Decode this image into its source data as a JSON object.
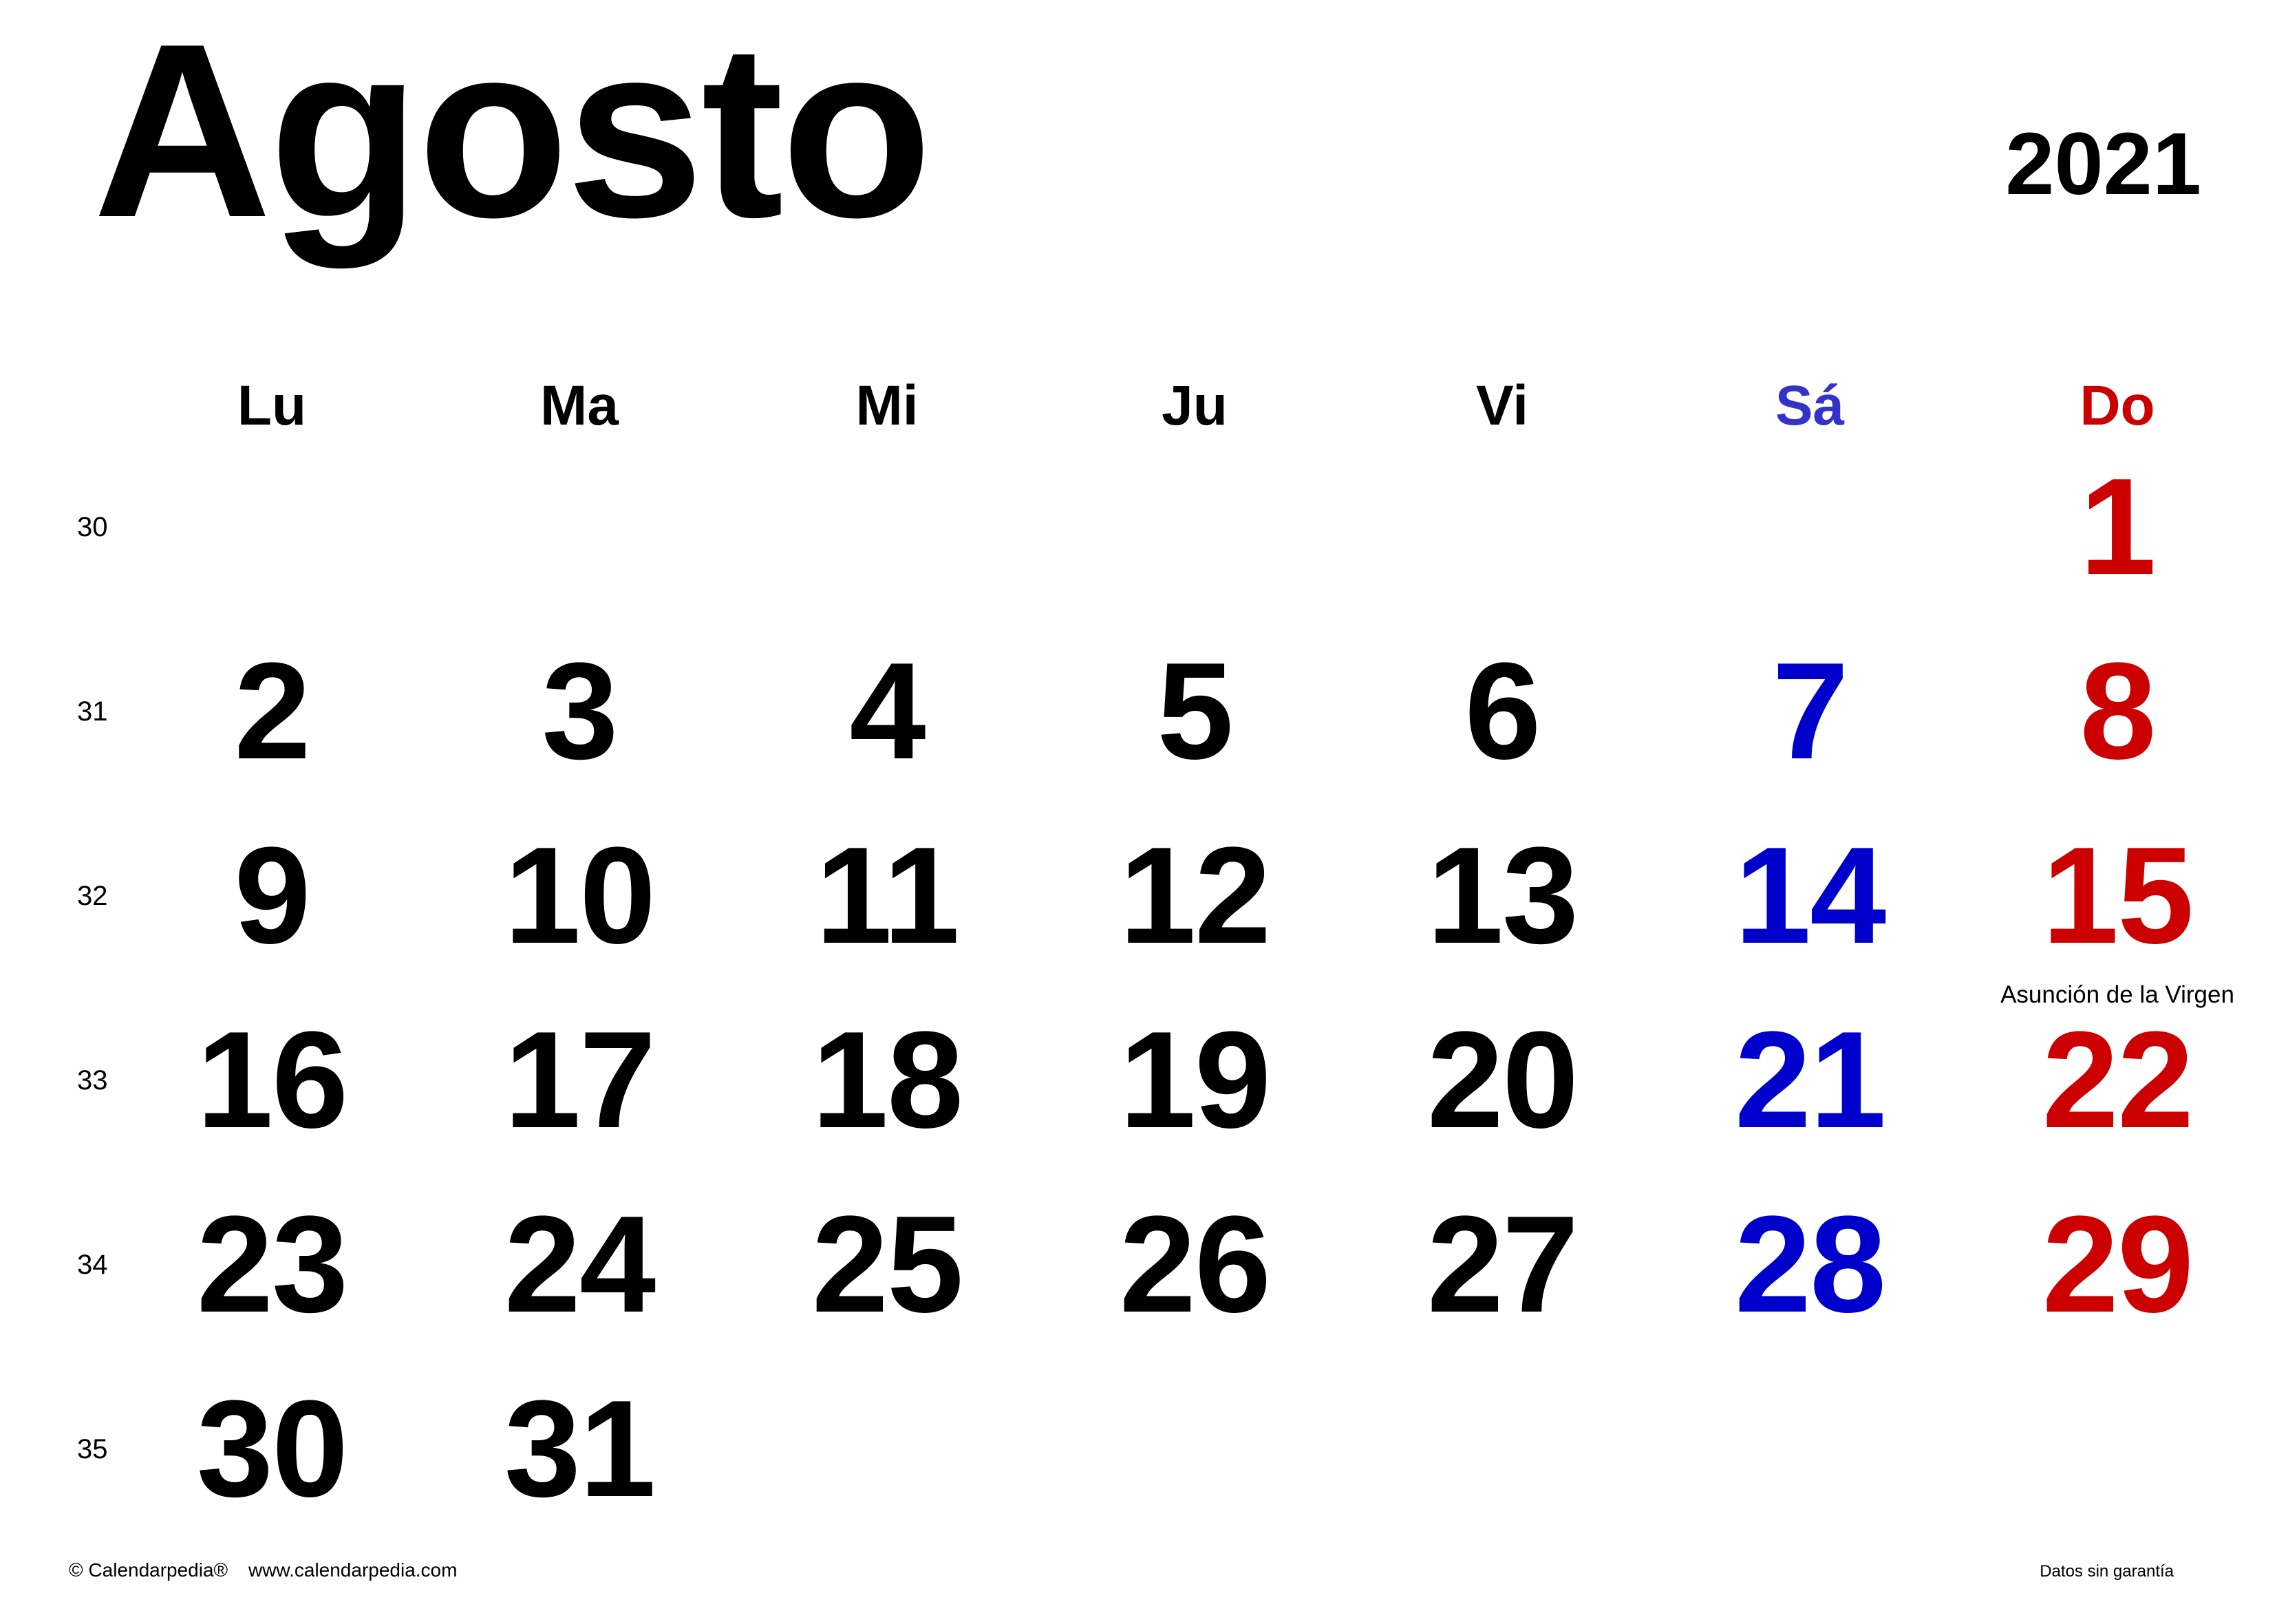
{
  "header": {
    "month": "Agosto",
    "year": "2021"
  },
  "weekdays": [
    {
      "label": "Lu",
      "color": "#000000"
    },
    {
      "label": "Ma",
      "color": "#000000"
    },
    {
      "label": "Mi",
      "color": "#000000"
    },
    {
      "label": "Ju",
      "color": "#000000"
    },
    {
      "label": "Vi",
      "color": "#000000"
    },
    {
      "label": "Sá",
      "color": "#3333cc"
    },
    {
      "label": "Do",
      "color": "#cc0000"
    }
  ],
  "colors": {
    "weekday_text": "#000000",
    "saturday": "#0000cc",
    "sunday": "#cc0000"
  },
  "weeks": [
    {
      "number": "30",
      "days": [
        "",
        "",
        "",
        "",
        "",
        "",
        "1"
      ]
    },
    {
      "number": "31",
      "days": [
        "2",
        "3",
        "4",
        "5",
        "6",
        "7",
        "8"
      ]
    },
    {
      "number": "32",
      "days": [
        "9",
        "10",
        "11",
        "12",
        "13",
        "14",
        "15"
      ]
    },
    {
      "number": "33",
      "days": [
        "16",
        "17",
        "18",
        "19",
        "20",
        "21",
        "22"
      ]
    },
    {
      "number": "34",
      "days": [
        "23",
        "24",
        "25",
        "26",
        "27",
        "28",
        "29"
      ]
    },
    {
      "number": "35",
      "days": [
        "30",
        "31",
        "",
        "",
        "",
        "",
        ""
      ]
    }
  ],
  "holidays": [
    {
      "day": "15",
      "name": "Asunción de la Virgen"
    }
  ],
  "footer": {
    "copyright": "© Calendarpedia®",
    "website": "www.calendarpedia.com",
    "disclaimer": "Datos sin garantía"
  }
}
